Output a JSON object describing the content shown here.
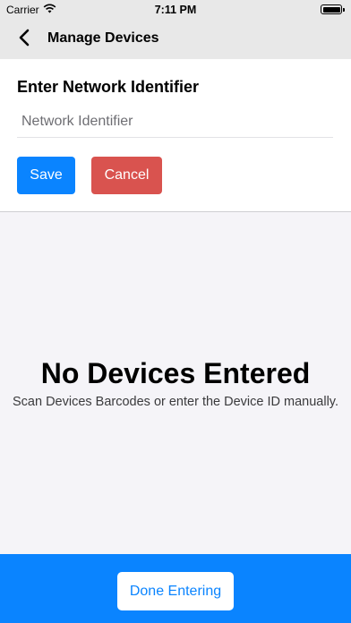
{
  "status_bar": {
    "carrier": "Carrier",
    "time": "7:11 PM",
    "icons": [
      "wifi-icon",
      "battery-icon"
    ]
  },
  "nav": {
    "title": "Manage Devices",
    "back_icon": "chevron-left-icon"
  },
  "entry": {
    "heading": "Enter Network Identifier",
    "input_value": "",
    "input_placeholder": "Network Identifier",
    "save_label": "Save",
    "cancel_label": "Cancel"
  },
  "empty_state": {
    "title": "No Devices Entered",
    "subtitle": "Scan Devices Barcodes or enter the Device ID manually."
  },
  "footer": {
    "done_label": "Done Entering"
  },
  "colors": {
    "accent": "#0a84ff",
    "danger": "#d9534f",
    "bar_bg": "#e8e8e8",
    "page_bg": "#f5f4f8"
  }
}
